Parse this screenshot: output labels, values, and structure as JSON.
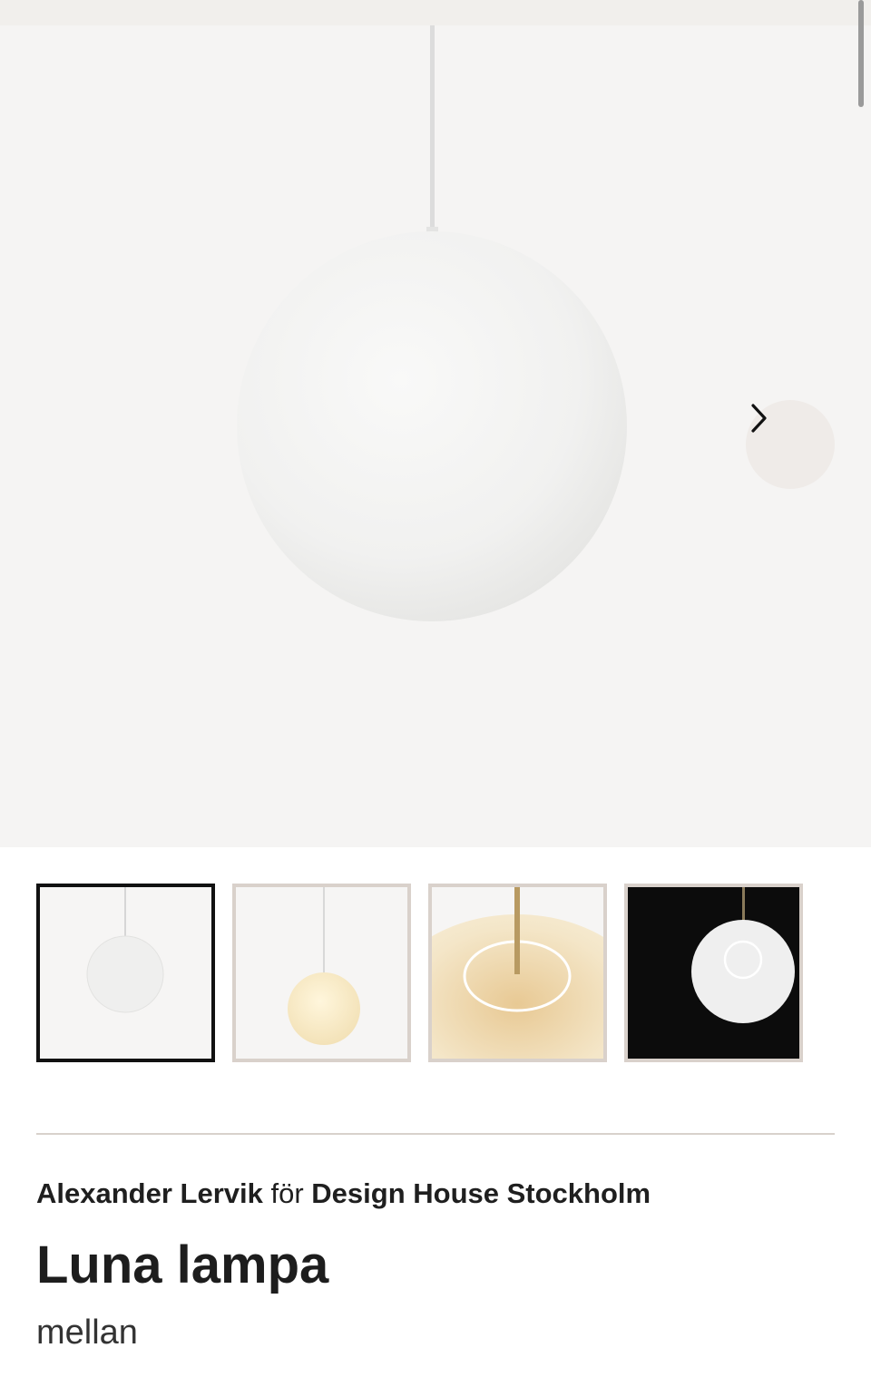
{
  "gallery": {
    "thumbnails": [
      {
        "label": "White pendant lamp",
        "selected": true
      },
      {
        "label": "Warm lit pendant lamp",
        "selected": false
      },
      {
        "label": "Lamp close-up, brass stem",
        "selected": false
      },
      {
        "label": "Lamp from below, dark background",
        "selected": false
      }
    ],
    "next_icon": "chevron-right-icon"
  },
  "product": {
    "designer": "Alexander Lervik",
    "connector": "för",
    "brand": "Design House Stockholm",
    "title": "Luna lampa",
    "variant": "mellan"
  },
  "colors": {
    "background": "#ffffff",
    "image_background": "#f5f4f3",
    "selected_border": "#111111",
    "thumb_border": "#d9d1cb",
    "text": "#1f1f1f"
  }
}
